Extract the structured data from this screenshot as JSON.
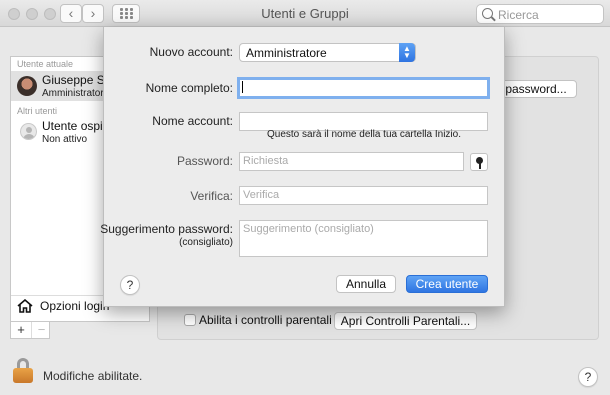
{
  "window": {
    "title": "Utenti e Gruppi",
    "search_placeholder": "Ricerca",
    "nav_back": "‹",
    "nav_forward": "›"
  },
  "sidebar": {
    "current_user_header": "Utente attuale",
    "current_user": {
      "name": "Giuseppe Se",
      "role": "Amministrator"
    },
    "other_users_header": "Altri utenti",
    "guest_user": {
      "name": "Utente ospit",
      "status": "Non attivo"
    },
    "login_options": "Opzioni login",
    "add": "+",
    "remove": "−"
  },
  "panel": {
    "change_password_button": "password...",
    "parental_checkbox_label": "Abilita i controlli parentali",
    "parental_checked": false,
    "open_parental_button": "Apri Controlli Parentali..."
  },
  "footer": {
    "lock_label": "Modifiche abilitate.",
    "help": "?"
  },
  "dialog": {
    "new_account_label": "Nuovo account:",
    "new_account_value": "Amministratore",
    "full_name_label": "Nome completo:",
    "full_name_value": "",
    "account_name_label": "Nome account:",
    "account_name_value": "",
    "account_name_hint": "Questo sarà il nome della tua cartella Inizio.",
    "password_label": "Password:",
    "password_placeholder": "Richiesta",
    "verify_label": "Verifica:",
    "verify_placeholder": "Verifica",
    "hint_label": "Suggerimento password:",
    "hint_label_sub": "(consigliato)",
    "hint_placeholder": "Suggerimento (consigliato)",
    "help": "?",
    "cancel_button": "Annulla",
    "create_button": "Crea utente"
  },
  "colors": {
    "accent": "#2f75e2",
    "focus_ring": "#7fb0ee",
    "lock": "#d98a37"
  }
}
